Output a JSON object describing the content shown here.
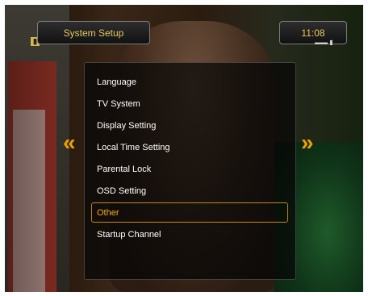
{
  "header": {
    "title": "System Setup",
    "clock": "11:08"
  },
  "menu": {
    "items": [
      {
        "label": "Language"
      },
      {
        "label": "TV System"
      },
      {
        "label": "Display Setting"
      },
      {
        "label": "Local Time Setting"
      },
      {
        "label": "Parental Lock"
      },
      {
        "label": "OSD Setting"
      },
      {
        "label": "Other"
      },
      {
        "label": "Startup Channel"
      }
    ],
    "selected_label": "Other"
  },
  "nav": {
    "left_arrow": "«",
    "right_arrow": "»"
  },
  "colors": {
    "accent": "#f0a000",
    "title_text": "#e8c85a",
    "menu_text": "#ffffff"
  },
  "icons": [
    "channel-badge-icon",
    "tv-logo-icon",
    "left-double-arrow-icon",
    "right-double-arrow-icon"
  ]
}
